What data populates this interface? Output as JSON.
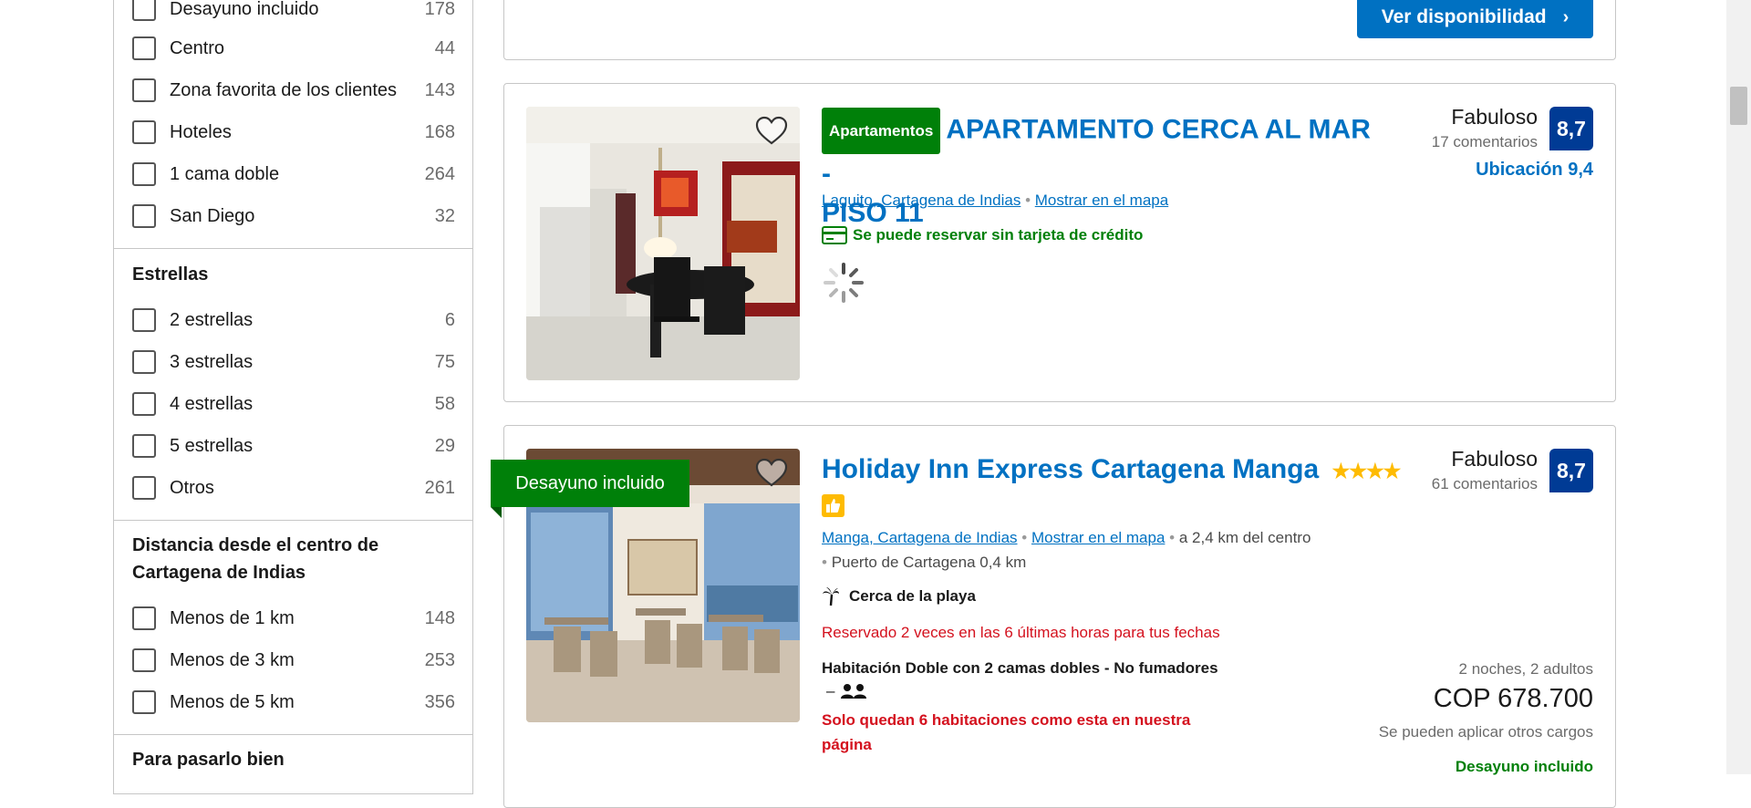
{
  "filters": {
    "popular": [
      {
        "label": "Desayuno incluido",
        "count": "178"
      },
      {
        "label": "Centro",
        "count": "44"
      },
      {
        "label": "Zona favorita de los clientes",
        "count": "143"
      },
      {
        "label": "Hoteles",
        "count": "168"
      },
      {
        "label": "1 cama doble",
        "count": "264"
      },
      {
        "label": "San Diego",
        "count": "32"
      }
    ],
    "stars_title": "Estrellas",
    "stars": [
      {
        "label": "2 estrellas",
        "count": "6"
      },
      {
        "label": "3 estrellas",
        "count": "75"
      },
      {
        "label": "4 estrellas",
        "count": "58"
      },
      {
        "label": "5 estrellas",
        "count": "29"
      },
      {
        "label": "Otros",
        "count": "261"
      }
    ],
    "distance_title": "Distancia desde el centro de Cartagena de Indias",
    "distance": [
      {
        "label": "Menos de 1 km",
        "count": "148"
      },
      {
        "label": "Menos de 3 km",
        "count": "253"
      },
      {
        "label": "Menos de 5 km",
        "count": "356"
      }
    ],
    "fun_title": "Para pasarlo bien"
  },
  "previous_card": {
    "availability_button": "Ver disponibilidad"
  },
  "card1": {
    "badge": "Apartamentos",
    "title_line1": "APARTAMENTO CERCA AL MAR -",
    "title_line2": "PISO 11",
    "location": "Laguito, Cartagena de Indias",
    "map_link": "Mostrar en el mapa",
    "no_card": "Se puede reservar sin tarjeta de crédito",
    "score_word": "Fabuloso",
    "reviews": "17 comentarios",
    "score": "8,7",
    "location_score": "Ubicación 9,4"
  },
  "card2": {
    "ribbon": "Desayuno incluido",
    "title": "Holiday Inn Express Cartagena Manga",
    "location": "Manga, Cartagena de Indias",
    "map_link": "Mostrar en el mapa",
    "distance": "a 2,4 km del centro",
    "landmark": "Puerto de Cartagena 0,4 km",
    "beach": "Cerca de la playa",
    "booked": "Reservado 2 veces en las 6 últimas horas para tus fechas",
    "room": "Habitación Doble con 2 camas dobles - No fumadores",
    "beds_prefix": "–",
    "scarcity": "Solo quedan 6 habitaciones como esta en nuestra página",
    "score_word": "Fabuloso",
    "reviews": "61 comentarios",
    "score": "8,7",
    "stay": "2 noches, 2 adultos",
    "price": "COP 678.700",
    "charges": "Se pueden aplicar otros cargos",
    "breakfast": "Desayuno incluido",
    "stars": 4
  },
  "colors": {
    "link": "#0071c2",
    "green": "#008009",
    "score_bg": "#003b95",
    "urgent_red": "#d4111e",
    "star": "#febb02"
  }
}
